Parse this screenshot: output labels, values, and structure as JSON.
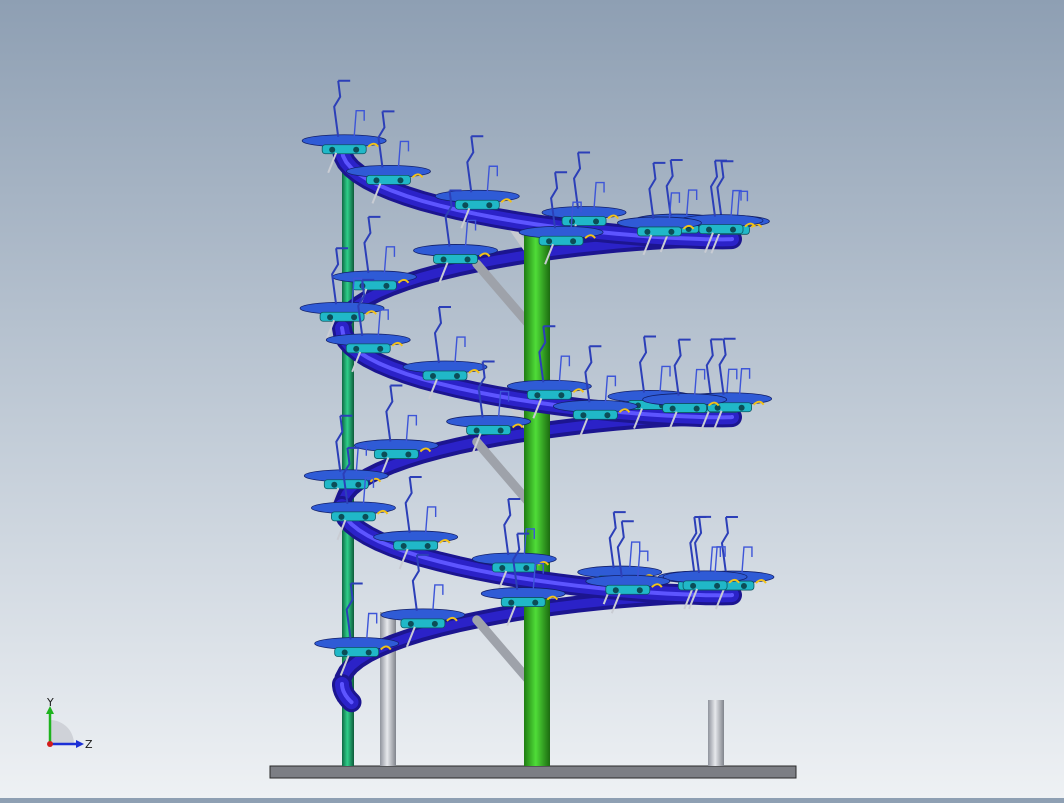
{
  "viewport": {
    "background_top": "#8e9fb3",
    "background_bottom": "#eef1f4"
  },
  "model": {
    "helix_color": "#2b22c8",
    "helix_highlight": "#5d55ff",
    "center_column_color": "#33b81f",
    "rear_column_color": "#1fa068",
    "support_color": "#b9bcc4",
    "platform_color": "#2f5bd6",
    "mechanism_color": "#20b8c8",
    "handle_color": "#2c3fb8",
    "hook_color": "#f2c21a",
    "base_color": "#7c7e84"
  },
  "triad": {
    "y_label": "Y",
    "z_label": "Z",
    "y_color": "#1eb31e",
    "z_color": "#1b2fd6",
    "x_color": "#d21c1c"
  }
}
